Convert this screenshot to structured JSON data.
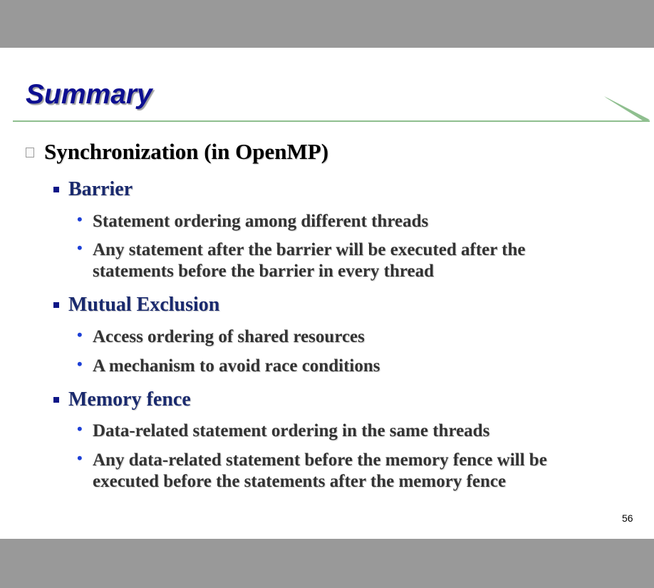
{
  "slide": {
    "title": "Summary",
    "page_number": "56",
    "heading": "Synchronization (in OpenMP)",
    "sections": [
      {
        "label": "Barrier",
        "bullets": [
          {
            "line1": "Statement ordering among different threads",
            "line2": ""
          },
          {
            "line1": "Any statement after the barrier will be executed after the",
            "line2": "statements before the barrier in every thread"
          }
        ]
      },
      {
        "label": "Mutual Exclusion",
        "bullets": [
          {
            "line1": "Access ordering of shared resources",
            "line2": ""
          },
          {
            "line1": "A mechanism to avoid race conditions",
            "line2": ""
          }
        ]
      },
      {
        "label": "Memory fence",
        "bullets": [
          {
            "line1": "Data-related statement ordering in the same threads",
            "line2": ""
          },
          {
            "line1": "Any data-related  statement before the memory fence will be",
            "line2": "executed before the statements after the memory fence"
          }
        ]
      }
    ]
  },
  "colors": {
    "title": "#0d0f91",
    "rule": "#8fbf8f",
    "level2": "#1a2a6e",
    "level3": "#333333",
    "bullet_dot": "#1c3fd6"
  }
}
